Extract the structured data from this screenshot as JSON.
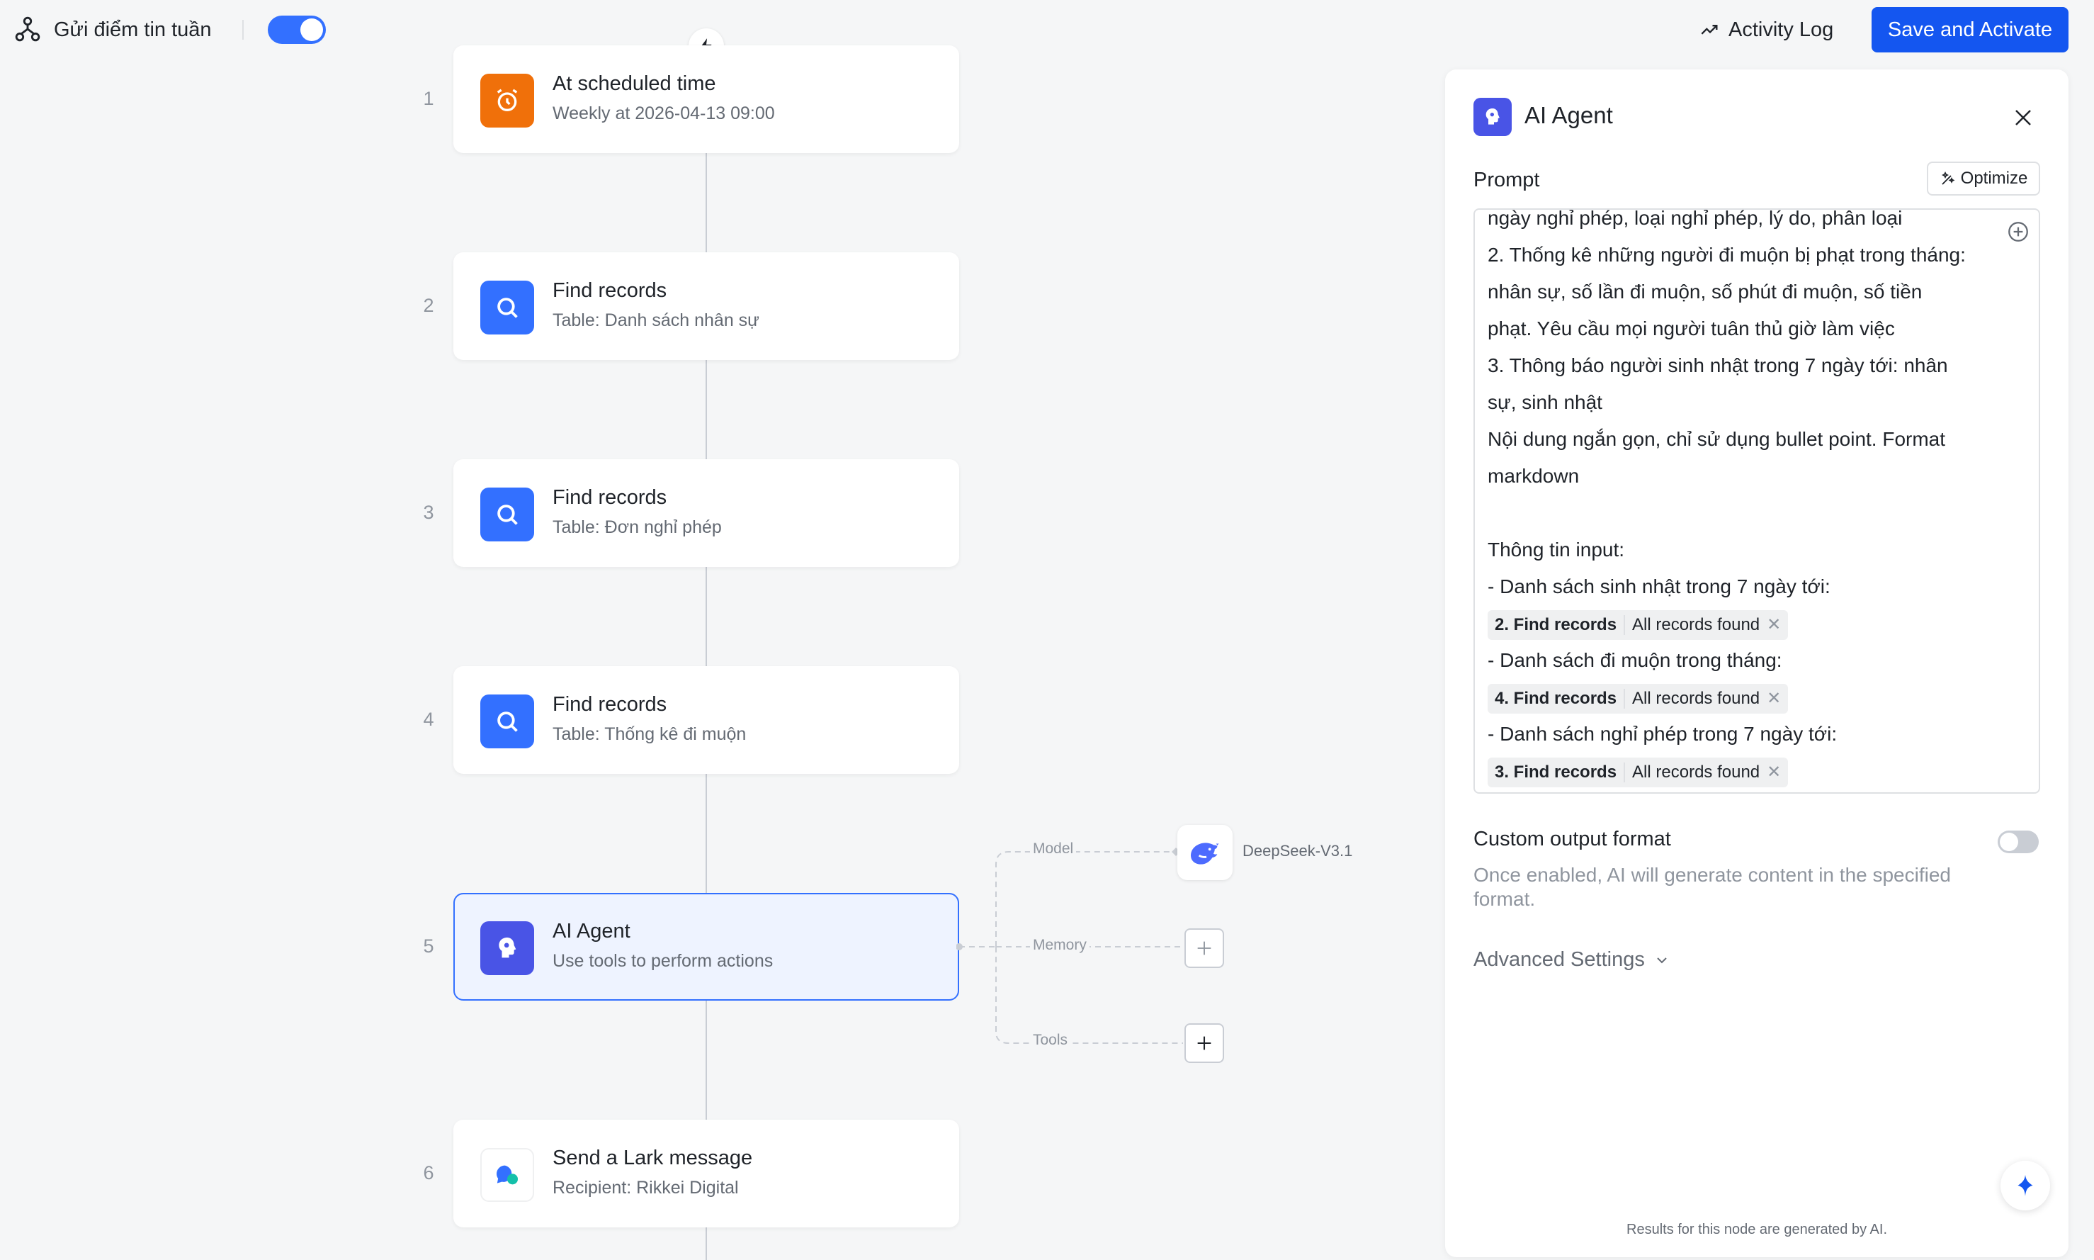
{
  "header": {
    "workflow_title": "Gửi điểm tin tuần",
    "enabled": true,
    "activity_log_label": "Activity Log",
    "save_label": "Save and Activate"
  },
  "canvas": {
    "nodes": [
      {
        "number": "1",
        "title": "At scheduled time",
        "subtitle": "Weekly at 2026-04-13 09:00",
        "icon": "alarm-clock-icon",
        "color": "#f0700a"
      },
      {
        "number": "2",
        "title": "Find records",
        "subtitle": "Table: Danh sách nhân sự",
        "icon": "search-icon",
        "color": "#3370ff"
      },
      {
        "number": "3",
        "title": "Find records",
        "subtitle": "Table: Đơn nghỉ phép",
        "icon": "search-icon",
        "color": "#3370ff"
      },
      {
        "number": "4",
        "title": "Find records",
        "subtitle": "Table: Thống kê đi muộn",
        "icon": "search-icon",
        "color": "#3370ff"
      },
      {
        "number": "5",
        "title": "AI Agent",
        "subtitle": "Use tools to perform actions",
        "icon": "ai-agent-icon",
        "color": "#4954e6",
        "selected": true
      },
      {
        "number": "6",
        "title": "Send a Lark message",
        "subtitle": "Recipient: Rikkei Digital",
        "icon": "lark-message-icon",
        "color": "#ffffff"
      }
    ],
    "agent_connections": {
      "model_label": "Model",
      "memory_label": "Memory",
      "tools_label": "Tools",
      "model_name": "DeepSeek-V3.1"
    }
  },
  "panel": {
    "title": "AI Agent",
    "prompt_label": "Prompt",
    "optimize_label": "Optimize",
    "prompt_lines": [
      "ngày nghỉ phép, loại nghỉ phép, lý do, phân loại",
      "2. Thống kê những người đi muộn bị phạt trong tháng:",
      "nhân sự, số lần đi muộn, số phút đi muộn, số tiền",
      "phạt. Yêu cầu mọi người tuân thủ giờ làm việc",
      "3. Thông báo người sinh nhật trong 7 ngày tới: nhân",
      "sự, sinh nhật",
      "Nội dung ngắn gọn, chỉ sử dụng bullet point. Format",
      "markdown",
      "",
      "Thông tin input:",
      "- Danh sách sinh nhật trong 7 ngày tới:"
    ],
    "pills": [
      {
        "step": "2. Find records",
        "value": "All records found"
      },
      {
        "step": "4. Find records",
        "value": "All records found"
      },
      {
        "step": "3. Find records",
        "value": "All records found"
      }
    ],
    "late_list_line": "- Danh sách đi muộn trong tháng:",
    "leave_list_line": "- Danh sách nghỉ phép trong 7 ngày tới:",
    "custom_output_label": "Custom output format",
    "custom_output_enabled": false,
    "custom_output_desc": "Once enabled, AI will generate content in the specified format.",
    "advanced_label": "Advanced Settings",
    "footer_note": "Results for this node are generated by AI."
  }
}
